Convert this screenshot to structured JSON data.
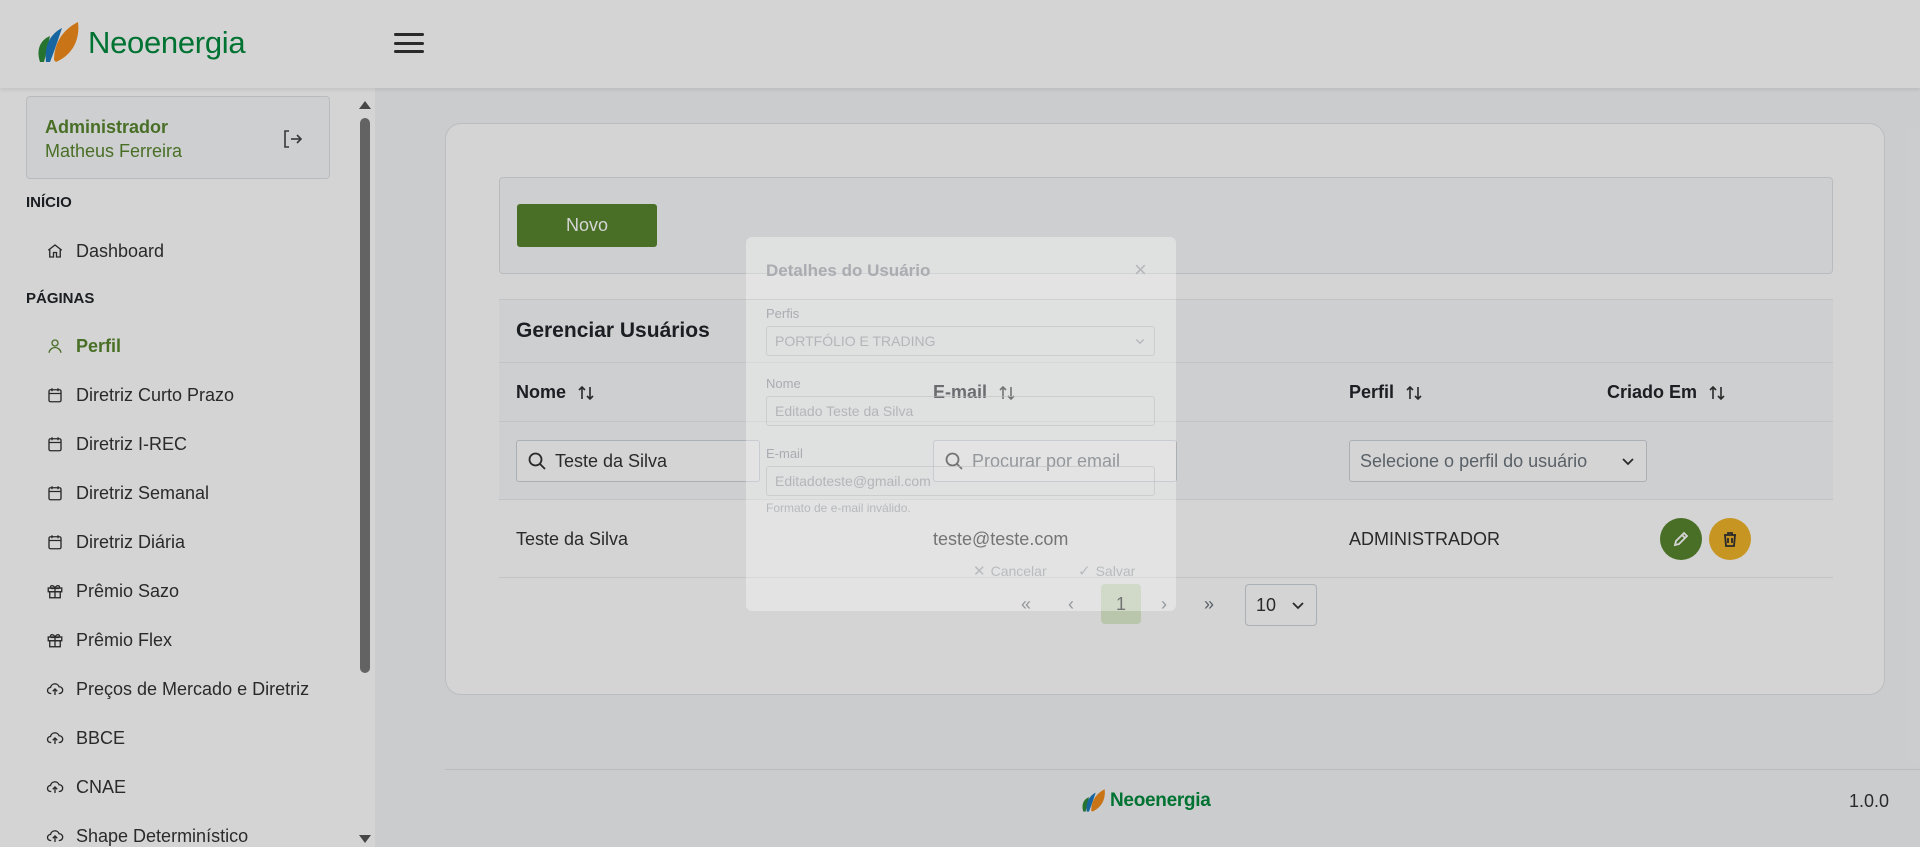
{
  "brand": {
    "name": "Neoenergia",
    "green": "#008a3d",
    "accent": "#58862f"
  },
  "user": {
    "role": "Administrador",
    "name": "Matheus Ferreira"
  },
  "sidebar": {
    "section_inicio": "INÍCIO",
    "section_paginas": "PÁGINAS",
    "items": [
      {
        "label": "Dashboard",
        "icon": "home-icon"
      },
      {
        "label": "Perfil",
        "icon": "user-icon",
        "active": true
      },
      {
        "label": "Diretriz Curto Prazo",
        "icon": "calendar-icon"
      },
      {
        "label": "Diretriz I-REC",
        "icon": "calendar-icon"
      },
      {
        "label": "Diretriz Semanal",
        "icon": "calendar-icon"
      },
      {
        "label": "Diretriz Diária",
        "icon": "calendar-icon"
      },
      {
        "label": "Prêmio Sazo",
        "icon": "gift-icon"
      },
      {
        "label": "Prêmio Flex",
        "icon": "gift-icon"
      },
      {
        "label": "Preços de Mercado e Diretriz",
        "icon": "cloud-upload-icon"
      },
      {
        "label": "BBCE",
        "icon": "cloud-upload-icon"
      },
      {
        "label": "CNAE",
        "icon": "cloud-upload-icon"
      },
      {
        "label": "Shape Determinístico",
        "icon": "cloud-upload-icon"
      }
    ]
  },
  "toolbar": {
    "new_label": "Novo"
  },
  "table": {
    "caption": "Gerenciar Usuários",
    "columns": [
      "Nome",
      "E-mail",
      "Perfil",
      "Criado Em"
    ],
    "filters": {
      "name_value": "Teste da Silva",
      "email_placeholder": "Procurar por email",
      "profile_placeholder": "Selecione o perfil do usuário"
    },
    "rows": [
      {
        "name": "Teste da Silva",
        "email": "teste@teste.com",
        "profile": "ADMINISTRADOR",
        "created": ""
      }
    ]
  },
  "paginator": {
    "first": "«",
    "prev": "‹",
    "current": "1",
    "next": "›",
    "last": "»",
    "rows_per_page": "10"
  },
  "footer": {
    "version": "1.0.0"
  },
  "modal": {
    "title": "Detalhes do Usuário",
    "close": "×",
    "profile_label": "Perfis",
    "profile_value": "PORTFÓLIO E TRADING",
    "name_label": "Nome",
    "name_value": "Editado Teste da Silva",
    "email_label": "E-mail",
    "email_value": "Editadoteste@gmail.com",
    "email_error": "Formato de e-mail inválido.",
    "cancel_label": "Cancelar",
    "save_label": "Salvar"
  }
}
